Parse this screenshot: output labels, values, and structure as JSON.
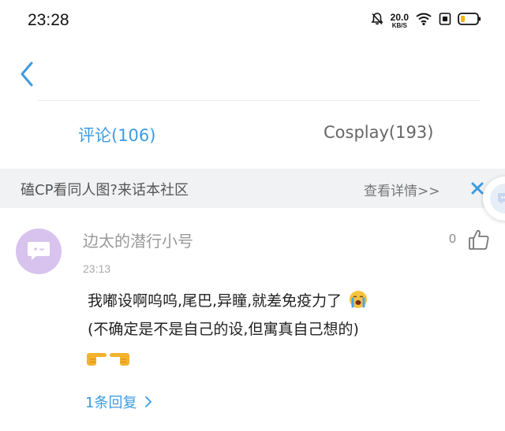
{
  "status_bar": {
    "time": "23:28",
    "net_speed_value": "20.0",
    "net_speed_unit": "KB/S",
    "icons": [
      "mute-bell-icon",
      "wifi-icon",
      "sim-icon",
      "battery-icon"
    ]
  },
  "header": {
    "back_icon": "chevron-left-icon"
  },
  "tabs": [
    {
      "label": "评论(106)",
      "active": true
    },
    {
      "label": "Cosplay(193)",
      "active": false
    }
  ],
  "banner": {
    "text": "磕CP看同人图?来话本社区",
    "link": "查看详情>>",
    "close_icon": "close-icon"
  },
  "comment": {
    "username": "边太的潜行小号",
    "time": "23:13",
    "likes": "0",
    "lines": [
      "我嘟设啊呜呜,尾巴,异瞳,就差免疫力了",
      "(不确定是不是自己的设,但寓真自己想的)"
    ],
    "emojis": [
      "crying-face-emoji",
      "pointing-right-hand-emoji",
      "pointing-left-hand-emoji"
    ],
    "replies": "1条回复"
  },
  "colors": {
    "accent": "#3d9be0",
    "banner_bg": "#f1f2f4",
    "avatar_bg": "#d7c3ee"
  }
}
